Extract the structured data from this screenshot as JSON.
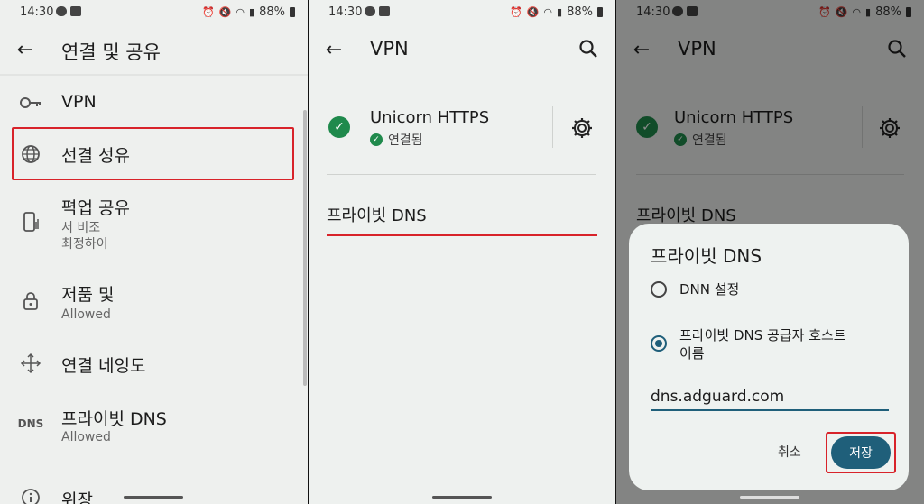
{
  "colors": {
    "accent": "#1f5f7a",
    "highlight": "#d8232a",
    "connected": "#1f8a4c"
  },
  "status_bar": {
    "time": "14:30",
    "battery": "88%"
  },
  "screen1": {
    "title": "연결 및 공유",
    "items": [
      {
        "icon": "key-icon",
        "title": "VPN",
        "subtitle": ""
      },
      {
        "icon": "globe-icon",
        "title": "선결 성유",
        "subtitle": ""
      },
      {
        "icon": "phone-signal-icon",
        "title": "펵업 공유",
        "subtitle": "서 비조\n최정하이"
      },
      {
        "icon": "lock-icon",
        "title": "저품 및",
        "subtitle": "Allowed"
      },
      {
        "icon": "move-arrows-icon",
        "title": "연결 네잉도",
        "subtitle": ""
      },
      {
        "icon": "dns-icon",
        "icon_text": "DNS",
        "title": "프라이빗 DNS",
        "subtitle": "Allowed"
      },
      {
        "icon": "info-icon",
        "title": "위장",
        "subtitle": ""
      }
    ]
  },
  "screen2": {
    "title": "VPN",
    "vpn_name": "Unicorn HTTPS",
    "vpn_status": "연결됨",
    "private_dns_label": "프라이빗 DNS"
  },
  "screen3": {
    "title": "VPN",
    "vpn_name": "Unicorn HTTPS",
    "vpn_status": "연결됨",
    "private_dns_label": "프라이빗 DNS",
    "dialog": {
      "title": "프라이빗 DNS",
      "option_off": "DNN 설정",
      "option_hostname_line1": "프라이빗 DNS 공급자 호스트",
      "option_hostname_line2": "이름",
      "hostname_value": "dns.adguard.com",
      "cancel_label": "취소",
      "save_label": "저장"
    }
  }
}
